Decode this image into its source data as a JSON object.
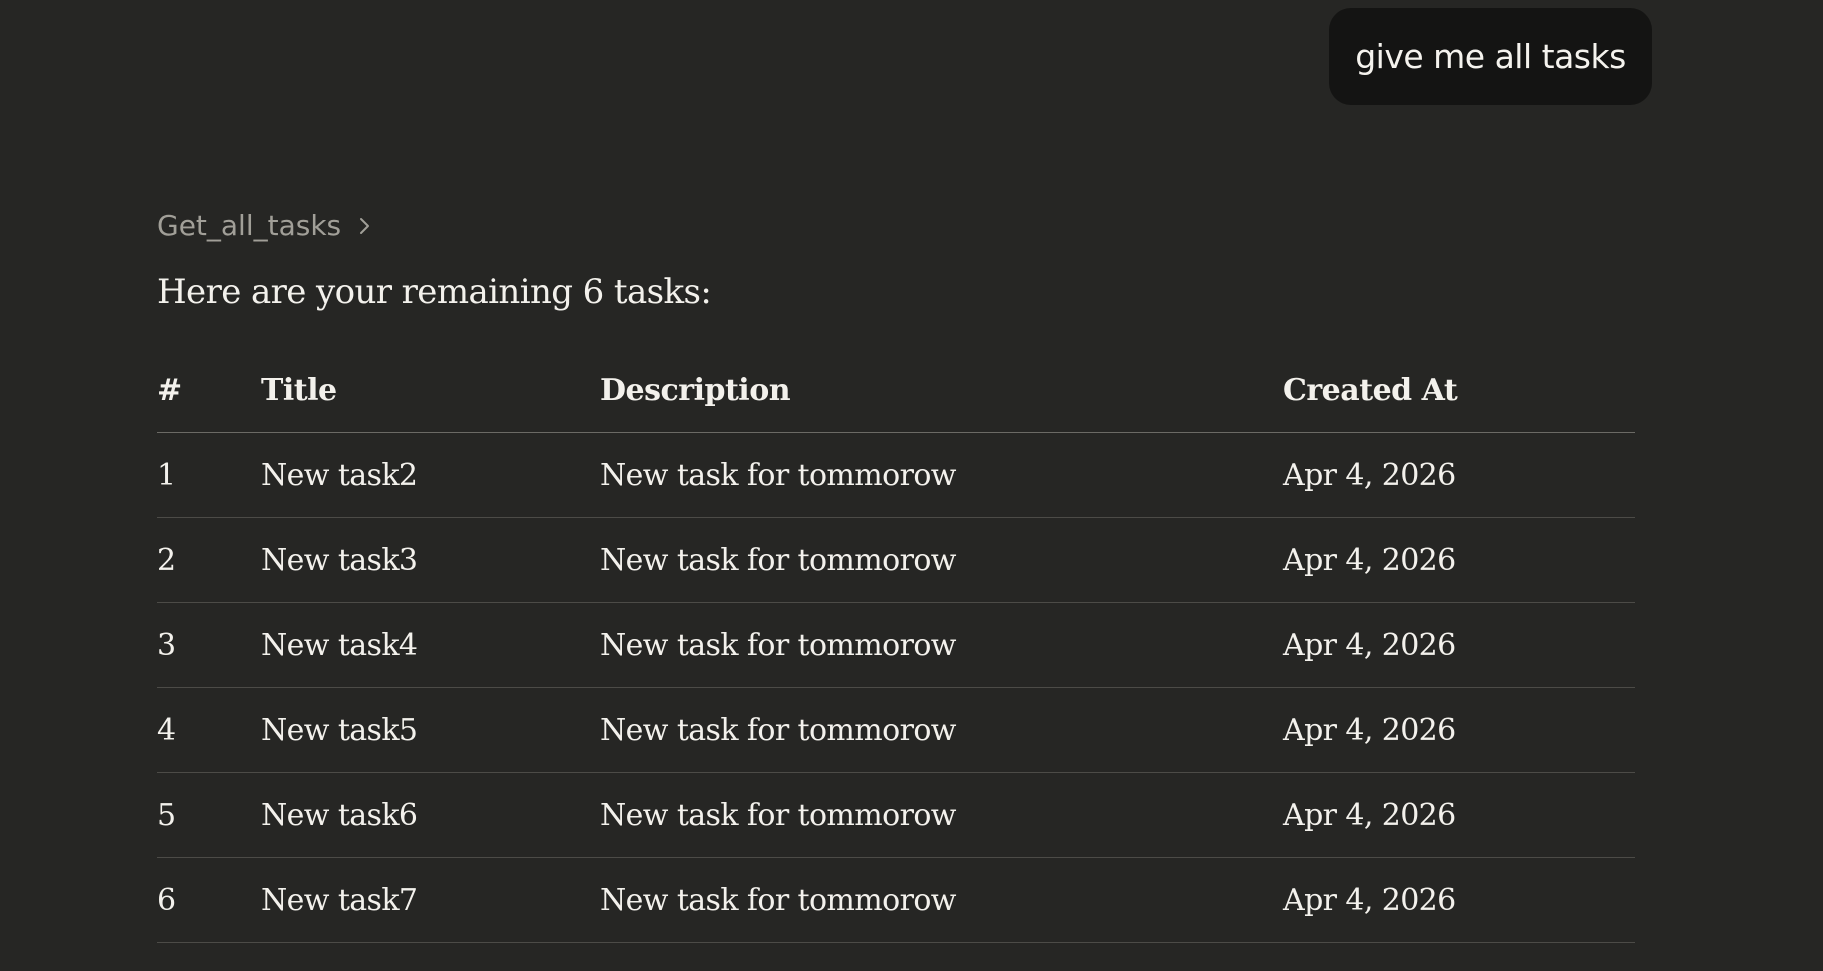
{
  "user_message": "give me all tasks",
  "tool_call": {
    "name": "Get_all_tasks",
    "icon": "chevron-right-icon"
  },
  "summary": "Here are your remaining 6 tasks:",
  "table": {
    "headers": [
      "#",
      "Title",
      "Description",
      "Created At"
    ],
    "rows": [
      {
        "num": "1",
        "title": "New task2",
        "description": "New task for tommorow",
        "created_at": "Apr 4, 2026"
      },
      {
        "num": "2",
        "title": "New task3",
        "description": "New task for tommorow",
        "created_at": "Apr 4, 2026"
      },
      {
        "num": "3",
        "title": "New task4",
        "description": "New task for tommorow",
        "created_at": "Apr 4, 2026"
      },
      {
        "num": "4",
        "title": "New task5",
        "description": "New task for tommorow",
        "created_at": "Apr 4, 2026"
      },
      {
        "num": "5",
        "title": "New task6",
        "description": "New task for tommorow",
        "created_at": "Apr 4, 2026"
      },
      {
        "num": "6",
        "title": "New task7",
        "description": "New task for tommorow",
        "created_at": "Apr 4, 2026"
      }
    ]
  },
  "colors": {
    "background": "#262624",
    "bubble": "#141413",
    "text": "#f3f1ec",
    "muted": "#a19f98"
  }
}
